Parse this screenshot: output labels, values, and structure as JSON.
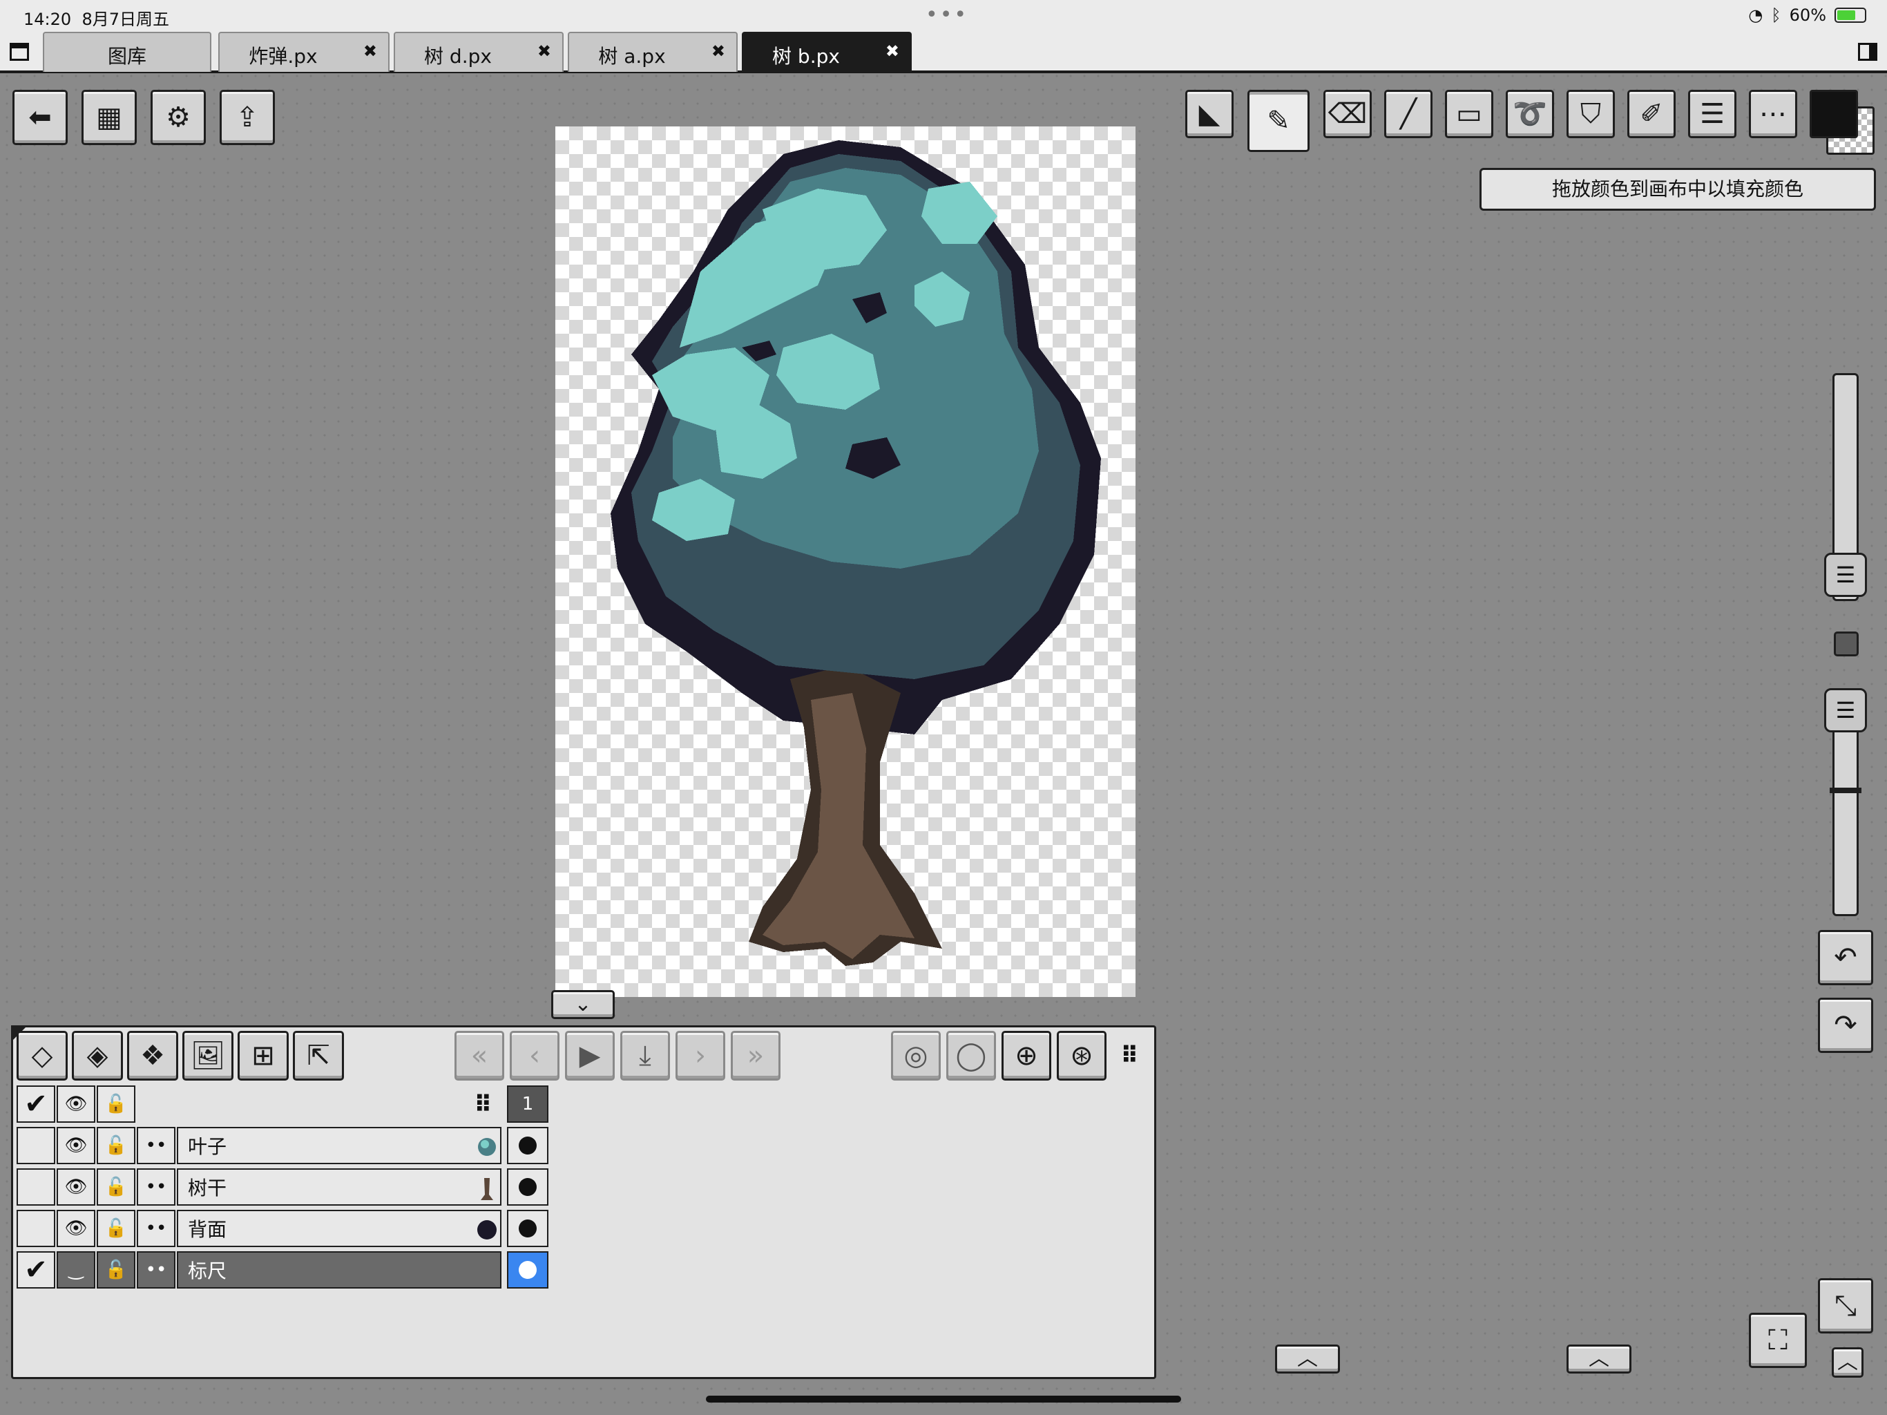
{
  "status_bar": {
    "time": "14:20",
    "date": "8月7日周五",
    "battery": "60%"
  },
  "tabs": [
    {
      "label": "图库",
      "active": false,
      "closable": false
    },
    {
      "label": "炸弹.px",
      "active": false,
      "closable": true
    },
    {
      "label": "树 d.px",
      "active": false,
      "closable": true
    },
    {
      "label": "树 a.px",
      "active": false,
      "closable": true
    },
    {
      "label": "树 b.px",
      "active": true,
      "closable": true
    }
  ],
  "close_glyph": "✖",
  "left_toolbar": [
    {
      "name": "back-button",
      "glyph": "⬅"
    },
    {
      "name": "canvas-settings-button",
      "glyph": "▦"
    },
    {
      "name": "settings-button",
      "glyph": "⚙"
    },
    {
      "name": "export-button",
      "glyph": "⇪"
    }
  ],
  "tools": [
    {
      "name": "select-tool",
      "glyph": "◣"
    },
    {
      "name": "pencil-tool",
      "glyph": "✎",
      "active": true
    },
    {
      "name": "eraser-tool",
      "glyph": "⌫"
    },
    {
      "name": "line-tool",
      "glyph": "╱"
    },
    {
      "name": "rectangle-tool",
      "glyph": "▭"
    },
    {
      "name": "lasso-tool",
      "glyph": "➰"
    },
    {
      "name": "fill-tool",
      "glyph": "⛉"
    },
    {
      "name": "eyedropper-tool",
      "glyph": "✐"
    },
    {
      "name": "adjust-tool",
      "glyph": "☰"
    },
    {
      "name": "more-tool",
      "glyph": "⋯"
    }
  ],
  "hint_text": "拖放颜色到画布中以填充颜色",
  "colors": {
    "primary": "#121212",
    "accent_blue": "#3a86f0"
  },
  "layer_toolbar": [
    {
      "name": "add-layer-button",
      "glyph": "◇"
    },
    {
      "name": "duplicate-layer-button",
      "glyph": "◈"
    },
    {
      "name": "merge-layer-button",
      "glyph": "❖"
    },
    {
      "name": "import-image-button",
      "glyph": "🖼"
    },
    {
      "name": "layer-grid-button",
      "glyph": "⊞"
    },
    {
      "name": "layer-export-button",
      "glyph": "⇱"
    }
  ],
  "playback": [
    {
      "name": "first-frame-button",
      "glyph": "«"
    },
    {
      "name": "prev-frame-button",
      "glyph": "‹"
    },
    {
      "name": "play-button",
      "glyph": "▶"
    },
    {
      "name": "onion-button",
      "glyph": "⤓"
    },
    {
      "name": "next-frame-button",
      "glyph": "›"
    },
    {
      "name": "last-frame-button",
      "glyph": "»"
    }
  ],
  "frame_tools": [
    {
      "name": "loop-frames-button",
      "glyph": "◎"
    },
    {
      "name": "frame-circle-button",
      "glyph": "◯"
    },
    {
      "name": "add-frame-button",
      "glyph": "⊕"
    },
    {
      "name": "add-frame-copy-button",
      "glyph": "⊛"
    }
  ],
  "frame_number": "1",
  "layers": [
    {
      "name": "叶子",
      "checked": false,
      "visible": true
    },
    {
      "name": "树干",
      "checked": false,
      "visible": true
    },
    {
      "name": "背面",
      "checked": false,
      "visible": true
    },
    {
      "name": "标尺",
      "checked": true,
      "visible": false,
      "selected": true
    }
  ],
  "glyphs": {
    "check": "✔",
    "eye": "👁",
    "eye_closed": "‿",
    "lock": "🔓",
    "dots": "••",
    "grip": "⠿",
    "chevron_down": "⌄",
    "chevron_up": "︿",
    "undo": "↶",
    "redo": "↷",
    "fullscreen": "⛶",
    "collapse": "⤡"
  }
}
